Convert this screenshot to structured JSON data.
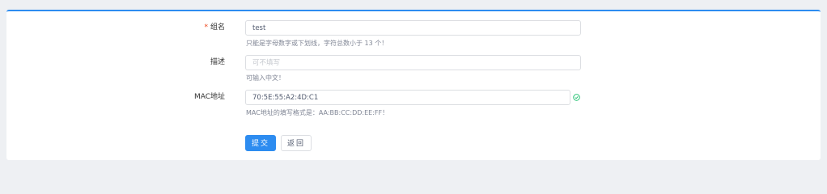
{
  "form": {
    "group_name": {
      "label": "组名",
      "required_mark": "*",
      "value": "test",
      "hint": "只能是字母数字或下划线，字符总数小于 13 个！"
    },
    "description": {
      "label": "描述",
      "value": "",
      "placeholder": "可不填写",
      "hint": "可输入中文！"
    },
    "mac_address": {
      "label": "MAC地址",
      "value": "70:5E:55:A2:4D:C1",
      "hint": "MAC地址的填写格式是：AA:BB:CC:DD:EE:FF！",
      "status_icon": "check-circle-icon"
    }
  },
  "actions": {
    "submit_label": "提交",
    "back_label": "返回"
  },
  "colors": {
    "primary": "#2d8cf0",
    "required": "#ed4014",
    "success": "#19be6b"
  }
}
